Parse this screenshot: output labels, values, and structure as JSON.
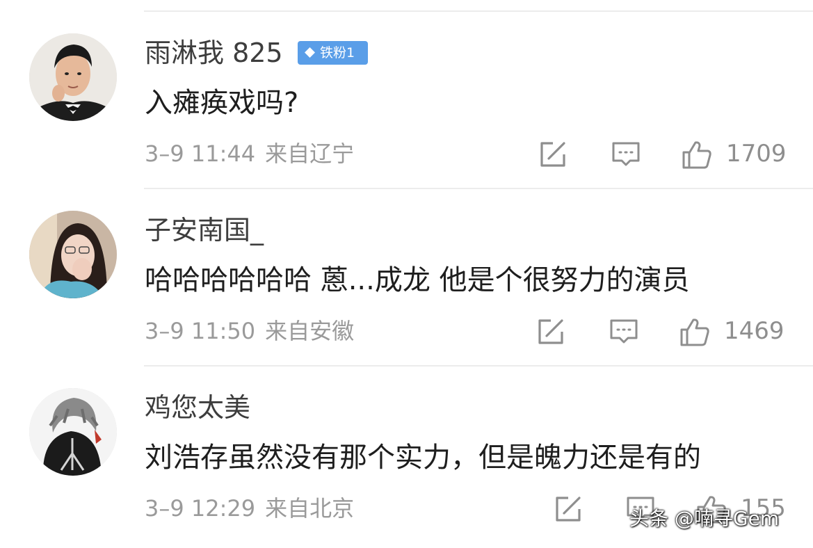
{
  "comments": [
    {
      "username": "雨淋我 825",
      "badge": "铁粉1",
      "text": "入瘫痪戏吗?",
      "time": "3–9 11:44",
      "location": "来自辽宁",
      "likes": "1709"
    },
    {
      "username": "子安南国_",
      "text": "哈哈哈哈哈哈 蒽...成龙 他是个很努力的演员",
      "time": "3–9 11:50",
      "location": "来自安徽",
      "likes": "1469"
    },
    {
      "username": "鸡您太美",
      "text": "刘浩存虽然没有那个实力，但是魄力还是有的",
      "time": "3–9 12:29",
      "location": "来自北京",
      "likes": "155"
    }
  ],
  "watermark": "头条 @喃寻Gem",
  "colors": {
    "badge": "#5a9ee8",
    "username": "#3d3d3d",
    "content": "#1e1e1e",
    "meta": "#9a9a9a",
    "icon": "#8e8e8e",
    "divider": "#ececec"
  },
  "icons": [
    "share-edit-icon",
    "comment-reply-icon",
    "thumbs-up-icon",
    "diamond-icon"
  ]
}
